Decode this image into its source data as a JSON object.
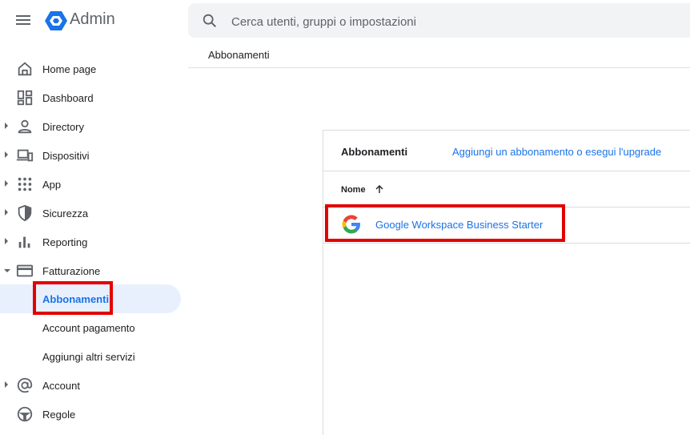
{
  "app": {
    "title": "Admin"
  },
  "search": {
    "placeholder": "Cerca utenti, gruppi o impostazioni"
  },
  "breadcrumb": "Abbonamenti",
  "sidebar": {
    "items": [
      {
        "label": "Home page",
        "icon": "home-icon"
      },
      {
        "label": "Dashboard",
        "icon": "dashboard-icon"
      },
      {
        "label": "Directory",
        "icon": "person-icon"
      },
      {
        "label": "Dispositivi",
        "icon": "devices-icon"
      },
      {
        "label": "App",
        "icon": "apps-grid-icon"
      },
      {
        "label": "Sicurezza",
        "icon": "shield-icon"
      },
      {
        "label": "Reporting",
        "icon": "bar-chart-icon"
      },
      {
        "label": "Fatturazione",
        "icon": "credit-card-icon"
      },
      {
        "label": "Abbonamenti"
      },
      {
        "label": "Account pagamento"
      },
      {
        "label": "Aggiungi altri servizi"
      },
      {
        "label": "Account",
        "icon": "at-sign-icon"
      },
      {
        "label": "Regole",
        "icon": "rules-icon"
      }
    ]
  },
  "main": {
    "card_title": "Abbonamenti",
    "action_link": "Aggiungi un abbonamento o esegui l'upgrade",
    "column_header": "Nome",
    "rows": [
      {
        "name": "Google Workspace Business Starter",
        "icon": "google-g-icon"
      }
    ]
  },
  "colors": {
    "accent": "#1a73e8",
    "highlight": "#e30000",
    "active_bg": "#e8f0fe"
  }
}
